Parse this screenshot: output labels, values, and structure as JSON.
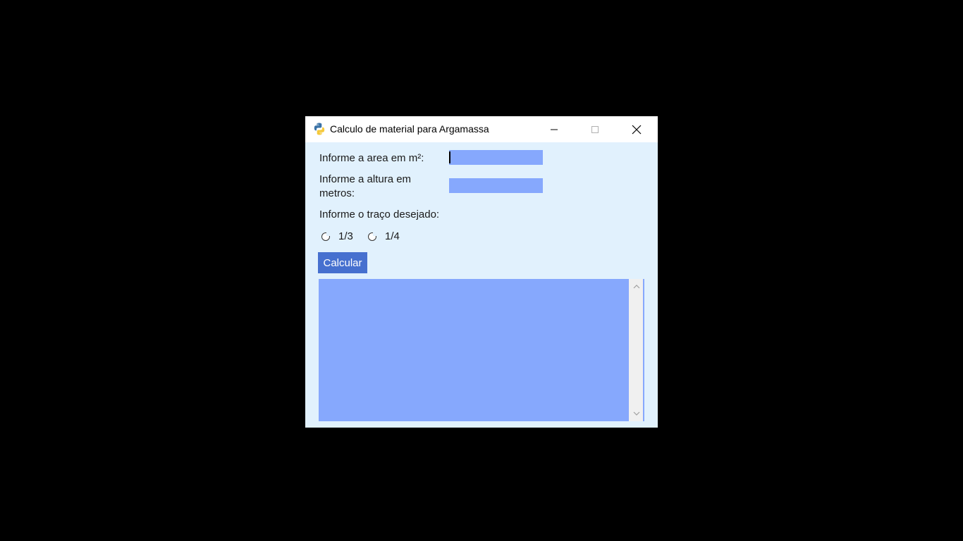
{
  "window": {
    "title": "Calculo de material para Argamassa",
    "icon": "python-icon"
  },
  "titlebar_buttons": {
    "minimize": "minimize-icon",
    "maximize": "maximize-icon",
    "close": "close-icon"
  },
  "form": {
    "area_label": "Informe a area em m²:",
    "area_value": "",
    "height_label_line1": "Informe a altura em",
    "height_label_line2": "metros:",
    "height_value": "",
    "trace_label": "Informe o traço desejado:",
    "options": [
      {
        "label": "1/3",
        "selected": false
      },
      {
        "label": "1/4",
        "selected": false
      }
    ],
    "calculate_label": "Calcular"
  },
  "output": {
    "text": ""
  },
  "colors": {
    "background": "#e1f1fd",
    "entry": "#86a8fd",
    "button": "#4670cf"
  }
}
